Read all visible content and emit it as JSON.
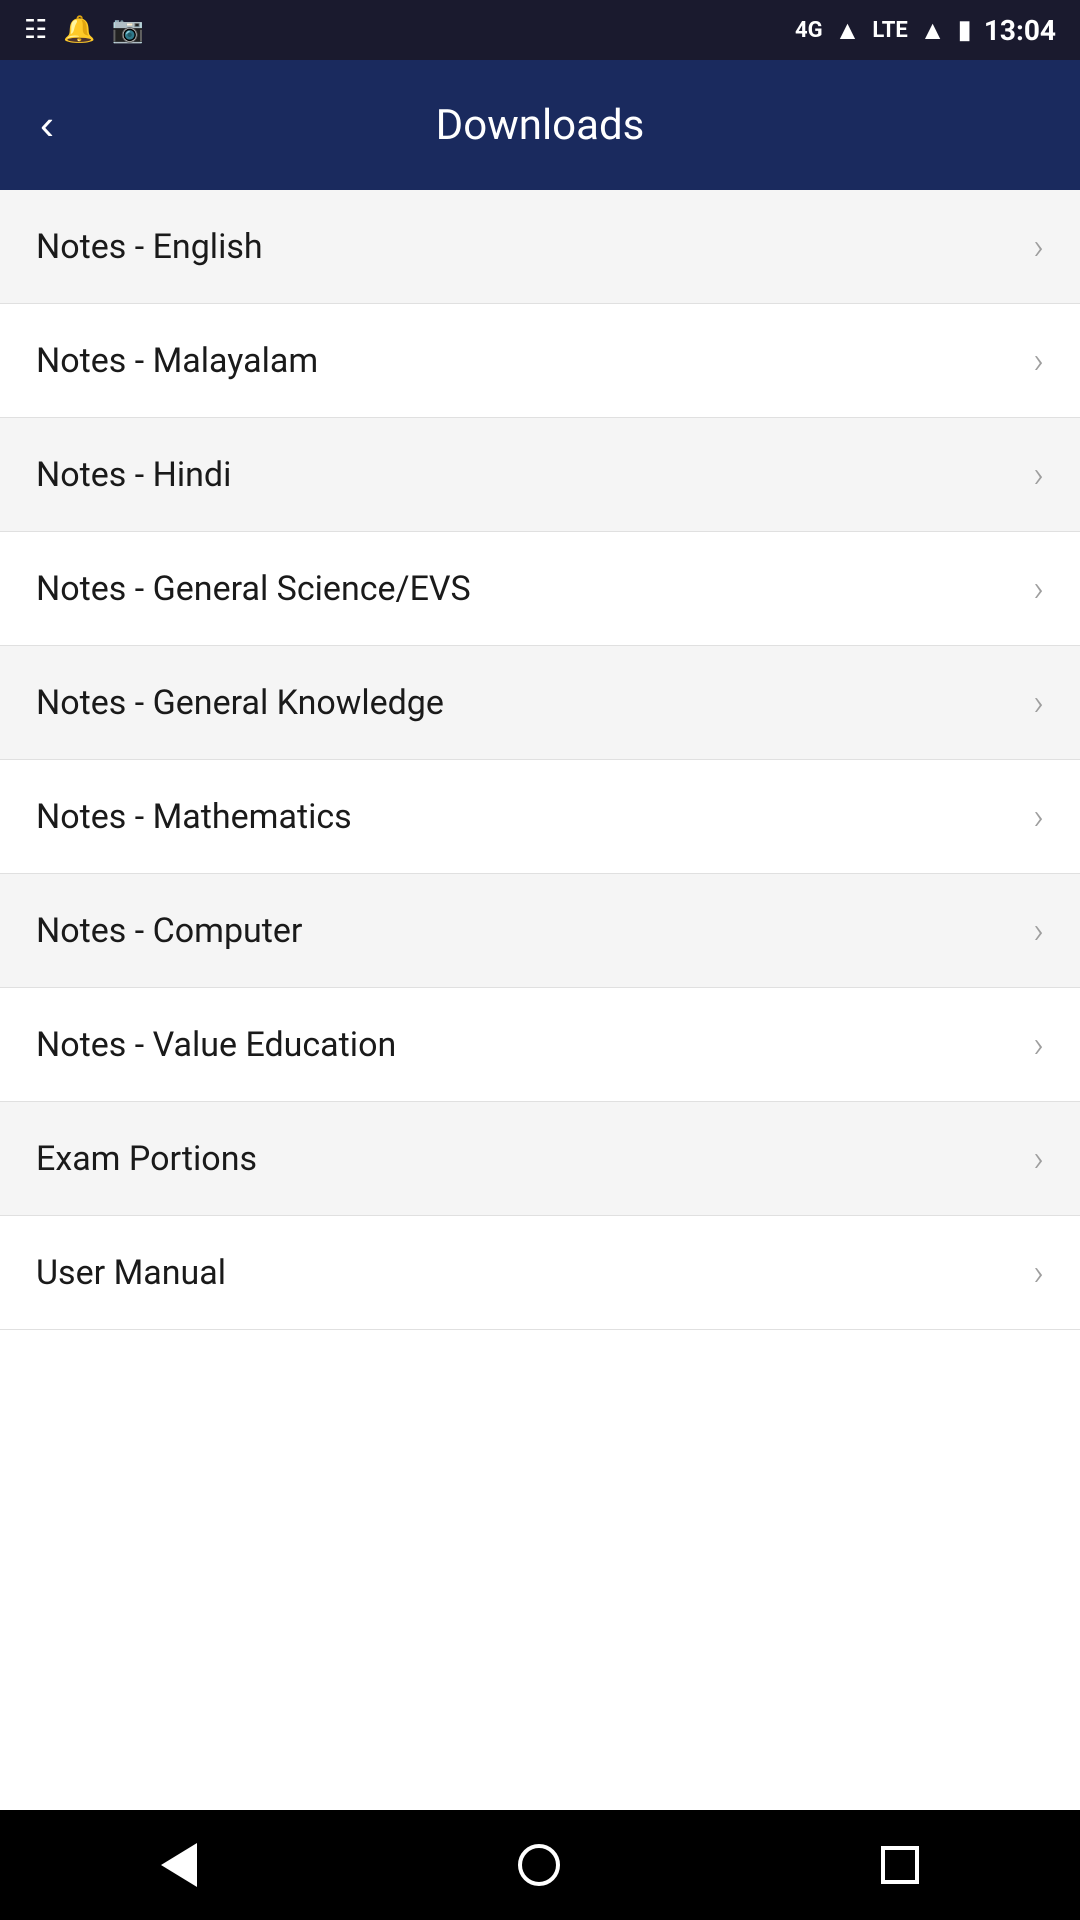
{
  "statusBar": {
    "time": "13:04",
    "icons": [
      "messages-icon",
      "notifications-icon",
      "photos-icon",
      "call-icon",
      "signal-4g-icon",
      "lte-icon",
      "signal-bars-icon",
      "battery-icon"
    ]
  },
  "appBar": {
    "title": "Downloads",
    "backButtonLabel": "<"
  },
  "listItems": [
    {
      "id": 1,
      "label": "Notes - English"
    },
    {
      "id": 2,
      "label": "Notes - Malayalam"
    },
    {
      "id": 3,
      "label": "Notes - Hindi"
    },
    {
      "id": 4,
      "label": "Notes - General Science/EVS"
    },
    {
      "id": 5,
      "label": "Notes - General Knowledge"
    },
    {
      "id": 6,
      "label": "Notes - Mathematics"
    },
    {
      "id": 7,
      "label": "Notes - Computer"
    },
    {
      "id": 8,
      "label": "Notes - Value Education"
    },
    {
      "id": 9,
      "label": "Exam Portions"
    },
    {
      "id": 10,
      "label": "User Manual"
    }
  ],
  "bottomNav": {
    "backLabel": "◁",
    "homeLabel": "○",
    "recentLabel": "□"
  }
}
